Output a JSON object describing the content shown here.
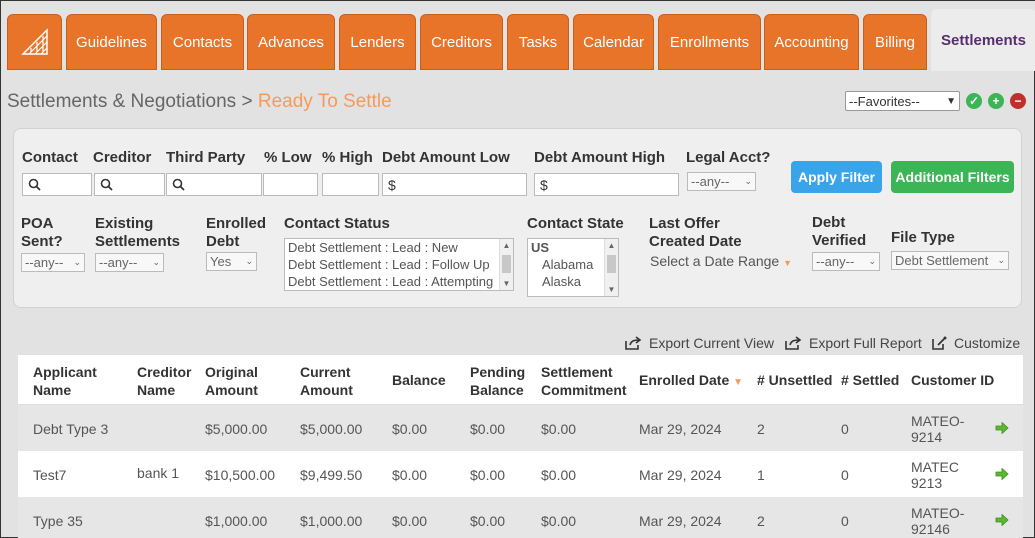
{
  "nav": {
    "tabs": [
      "Guidelines",
      "Contacts",
      "Advances",
      "Lenders",
      "Creditors",
      "Tasks",
      "Calendar",
      "Enrollments",
      "Accounting",
      "Billing",
      "Settlements"
    ],
    "active": "Settlements"
  },
  "header": {
    "breadcrumb_root": "Settlements & Negotiations",
    "separator": " > ",
    "breadcrumb_current": "Ready To Settle",
    "favorites_value": "--Favorites--"
  },
  "filters": {
    "contact_label": "Contact",
    "creditor_label": "Creditor",
    "third_party_label": "Third Party",
    "pct_low_label": "% Low",
    "pct_high_label": "% High",
    "debt_amount_low_label": "Debt Amount Low",
    "debt_amount_high_label": "Debt Amount High",
    "legal_acct_label": "Legal Acct?",
    "currency_symbol": "$",
    "legal_acct_value": "--any--",
    "apply_filter": "Apply Filter",
    "additional_filters": "Additional Filters",
    "poa_sent_label_1": "POA",
    "poa_sent_label_2": "Sent?",
    "poa_sent_value": "--any--",
    "existing_settlements_label_1": "Existing",
    "existing_settlements_label_2": "Settlements",
    "existing_settlements_value": "--any--",
    "enrolled_debt_label_1": "Enrolled",
    "enrolled_debt_label_2": "Debt",
    "enrolled_debt_value": "Yes",
    "contact_status_label": "Contact Status",
    "contact_status_options": [
      "Debt Settlement : Lead : New",
      "Debt Settlement : Lead : Follow Up",
      "Debt Settlement : Lead : Attempting"
    ],
    "contact_state_label": "Contact State",
    "contact_state_options": [
      "US",
      "Alabama",
      "Alaska"
    ],
    "last_offer_label_1": "Last Offer",
    "last_offer_label_2": "Created Date",
    "last_offer_value": "Select a Date Range",
    "debt_verified_label_1": "Debt",
    "debt_verified_label_2": "Verified",
    "debt_verified_value": "--any--",
    "file_type_label": "File Type",
    "file_type_value": "Debt Settlement"
  },
  "actions": {
    "export_current": "Export Current View",
    "export_full": "Export Full Report",
    "customize": "Customize"
  },
  "table": {
    "headers": {
      "applicant_1": "Applicant",
      "applicant_2": "Name",
      "creditor_1": "Creditor",
      "creditor_2": "Name",
      "original_1": "Original",
      "original_2": "Amount",
      "current_1": "Current",
      "current_2": "Amount",
      "balance": "Balance",
      "pending_1": "Pending",
      "pending_2": "Balance",
      "commitment_1": "Settlement",
      "commitment_2": "Commitment",
      "enrolled_date": "Enrolled Date",
      "unsettled": "# Unsettled",
      "settled": "# Settled",
      "customer_id": "Customer ID"
    },
    "rows": [
      {
        "applicant": "Debt Type 3",
        "creditor": "",
        "original": "$5,000.00",
        "current": "$5,000.00",
        "balance": "$0.00",
        "pending": "$0.00",
        "commitment": "$0.00",
        "enrolled": "Mar 29, 2024",
        "unsettled": "2",
        "settled": "0",
        "cid_1": "MATEO-",
        "cid_2": "9214"
      },
      {
        "applicant": "Test7",
        "creditor": "bank 1",
        "original": "$10,500.00",
        "current": "$9,499.50",
        "balance": "$0.00",
        "pending": "$0.00",
        "commitment": "$0.00",
        "enrolled": "Mar 29, 2024",
        "unsettled": "1",
        "settled": "0",
        "cid_1": "MATEC",
        "cid_2": "9213"
      },
      {
        "applicant": "Type 35",
        "creditor": "",
        "original": "$1,000.00",
        "current": "$1,000.00",
        "balance": "$0.00",
        "pending": "$0.00",
        "commitment": "$0.00",
        "enrolled": "Mar 29, 2024",
        "unsettled": "2",
        "settled": "0",
        "cid_1": "MATEO-",
        "cid_2": "92146"
      }
    ]
  },
  "colors": {
    "tab_orange": "#e8742a",
    "accent_light_orange": "#f59a5a",
    "apply_blue": "#3aa4e8",
    "filters_green": "#3cb556",
    "active_tab_text": "#5a2d6e"
  }
}
